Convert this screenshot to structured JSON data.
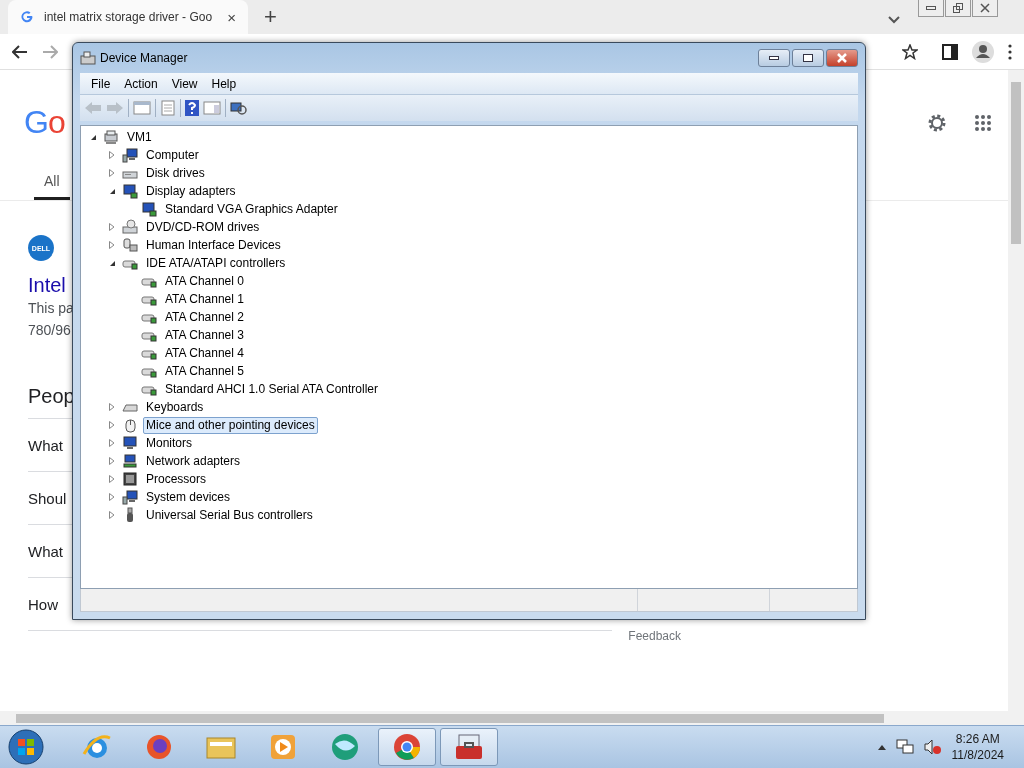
{
  "browser": {
    "tab": {
      "title": "intel matrix storage driver - Goo",
      "close": "×"
    },
    "new_tab": "+",
    "page": {
      "logo": "Go",
      "tabs": [
        {
          "label": "All",
          "selected": true
        }
      ],
      "result": {
        "source_logo": "DELL",
        "title": "Intel",
        "snippet": [
          "This pa",
          "780/96"
        ]
      },
      "people_also_ask": {
        "heading": "Peop",
        "questions": [
          "What",
          "Shoul",
          "What",
          "How"
        ]
      },
      "feedback": "Feedback"
    }
  },
  "device_manager": {
    "title": "Device Manager",
    "menu": [
      "File",
      "Action",
      "View",
      "Help"
    ],
    "tree": {
      "label": "VM1",
      "kind": "root",
      "expanded": true,
      "selected": false,
      "children": [
        {
          "label": "Computer",
          "kind": "computer",
          "expanded": false,
          "selected": false
        },
        {
          "label": "Disk drives",
          "kind": "disk",
          "expanded": false,
          "selected": false
        },
        {
          "label": "Display adapters",
          "kind": "display",
          "expanded": true,
          "selected": false,
          "children": [
            {
              "label": "Standard VGA Graphics Adapter",
              "kind": "display",
              "selected": false
            }
          ]
        },
        {
          "label": "DVD/CD-ROM drives",
          "kind": "dvd",
          "expanded": false,
          "selected": false
        },
        {
          "label": "Human Interface Devices",
          "kind": "hid",
          "expanded": false,
          "selected": false
        },
        {
          "label": "IDE ATA/ATAPI controllers",
          "kind": "ide",
          "expanded": true,
          "selected": false,
          "children": [
            {
              "label": "ATA Channel 0",
              "kind": "ide",
              "selected": false
            },
            {
              "label": "ATA Channel 1",
              "kind": "ide",
              "selected": false
            },
            {
              "label": "ATA Channel 2",
              "kind": "ide",
              "selected": false
            },
            {
              "label": "ATA Channel 3",
              "kind": "ide",
              "selected": false
            },
            {
              "label": "ATA Channel 4",
              "kind": "ide",
              "selected": false
            },
            {
              "label": "ATA Channel 5",
              "kind": "ide",
              "selected": false
            },
            {
              "label": "Standard AHCI 1.0 Serial ATA Controller",
              "kind": "ide",
              "selected": false
            }
          ]
        },
        {
          "label": "Keyboards",
          "kind": "keyboard",
          "expanded": false,
          "selected": false
        },
        {
          "label": "Mice and other pointing devices",
          "kind": "mouse",
          "expanded": false,
          "selected": true
        },
        {
          "label": "Monitors",
          "kind": "monitor",
          "expanded": false,
          "selected": false
        },
        {
          "label": "Network adapters",
          "kind": "network",
          "expanded": false,
          "selected": false
        },
        {
          "label": "Processors",
          "kind": "processor",
          "expanded": false,
          "selected": false
        },
        {
          "label": "System devices",
          "kind": "computer",
          "expanded": false,
          "selected": false
        },
        {
          "label": "Universal Serial Bus controllers",
          "kind": "usb",
          "expanded": false,
          "selected": false
        }
      ]
    }
  },
  "taskbar": {
    "apps": [
      {
        "kind": "ie",
        "active": false
      },
      {
        "kind": "firefox",
        "active": false
      },
      {
        "kind": "explorer",
        "active": false
      },
      {
        "kind": "media",
        "active": false
      },
      {
        "kind": "globe",
        "active": false
      },
      {
        "kind": "chrome",
        "active": true
      },
      {
        "kind": "toolbox",
        "active": true
      }
    ],
    "clock": {
      "time": "8:26 AM",
      "date": "11/8/2024"
    }
  }
}
